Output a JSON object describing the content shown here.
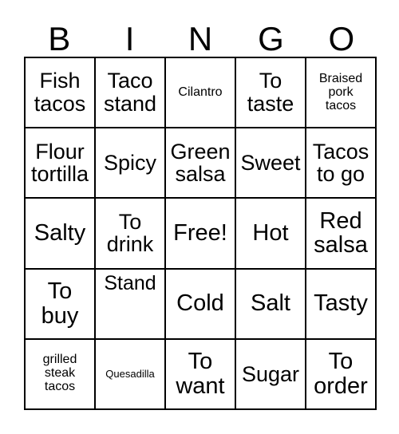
{
  "card": {
    "title": "BINGO card",
    "header_letters": [
      "B",
      "I",
      "N",
      "G",
      "O"
    ],
    "colors": {
      "grid_line": "#000000",
      "text": "#000000",
      "background": "#ffffff"
    },
    "rows": [
      [
        {
          "text": "Fish\ntacos",
          "size": "lg",
          "align": "center"
        },
        {
          "text": "Taco\nstand",
          "size": "lg",
          "align": "center"
        },
        {
          "text": "Cilantro",
          "size": "sm",
          "align": "center"
        },
        {
          "text": "To\ntaste",
          "size": "lg",
          "align": "center"
        },
        {
          "text": "Braised\npork\ntacos",
          "size": "sm",
          "align": "center"
        }
      ],
      [
        {
          "text": "Flour\ntortilla",
          "size": "lg",
          "align": "center"
        },
        {
          "text": "Spicy",
          "size": "lg",
          "align": "center"
        },
        {
          "text": "Green\nsalsa",
          "size": "lg",
          "align": "center"
        },
        {
          "text": "Sweet",
          "size": "lg",
          "align": "center"
        },
        {
          "text": "Tacos\nto go",
          "size": "lg",
          "align": "center"
        }
      ],
      [
        {
          "text": "Salty",
          "size": "xl",
          "align": "center"
        },
        {
          "text": "To\ndrink",
          "size": "lg",
          "align": "center"
        },
        {
          "text": "Free!",
          "size": "xl",
          "align": "center"
        },
        {
          "text": "Hot",
          "size": "xl",
          "align": "center"
        },
        {
          "text": "Red\nsalsa",
          "size": "xl",
          "align": "center"
        }
      ],
      [
        {
          "text": "To\nbuy",
          "size": "xl",
          "align": "center"
        },
        {
          "text": "Stand",
          "size": "md",
          "align": "top"
        },
        {
          "text": "Cold",
          "size": "xl",
          "align": "center"
        },
        {
          "text": "Salt",
          "size": "xl",
          "align": "center"
        },
        {
          "text": "Tasty",
          "size": "xl",
          "align": "center"
        }
      ],
      [
        {
          "text": "grilled\nsteak\ntacos",
          "size": "sm",
          "align": "center"
        },
        {
          "text": "Quesadilla",
          "size": "xs",
          "align": "center"
        },
        {
          "text": "To\nwant",
          "size": "xl",
          "align": "center"
        },
        {
          "text": "Sugar",
          "size": "lg",
          "align": "center"
        },
        {
          "text": "To\norder",
          "size": "xl",
          "align": "center"
        }
      ]
    ]
  }
}
